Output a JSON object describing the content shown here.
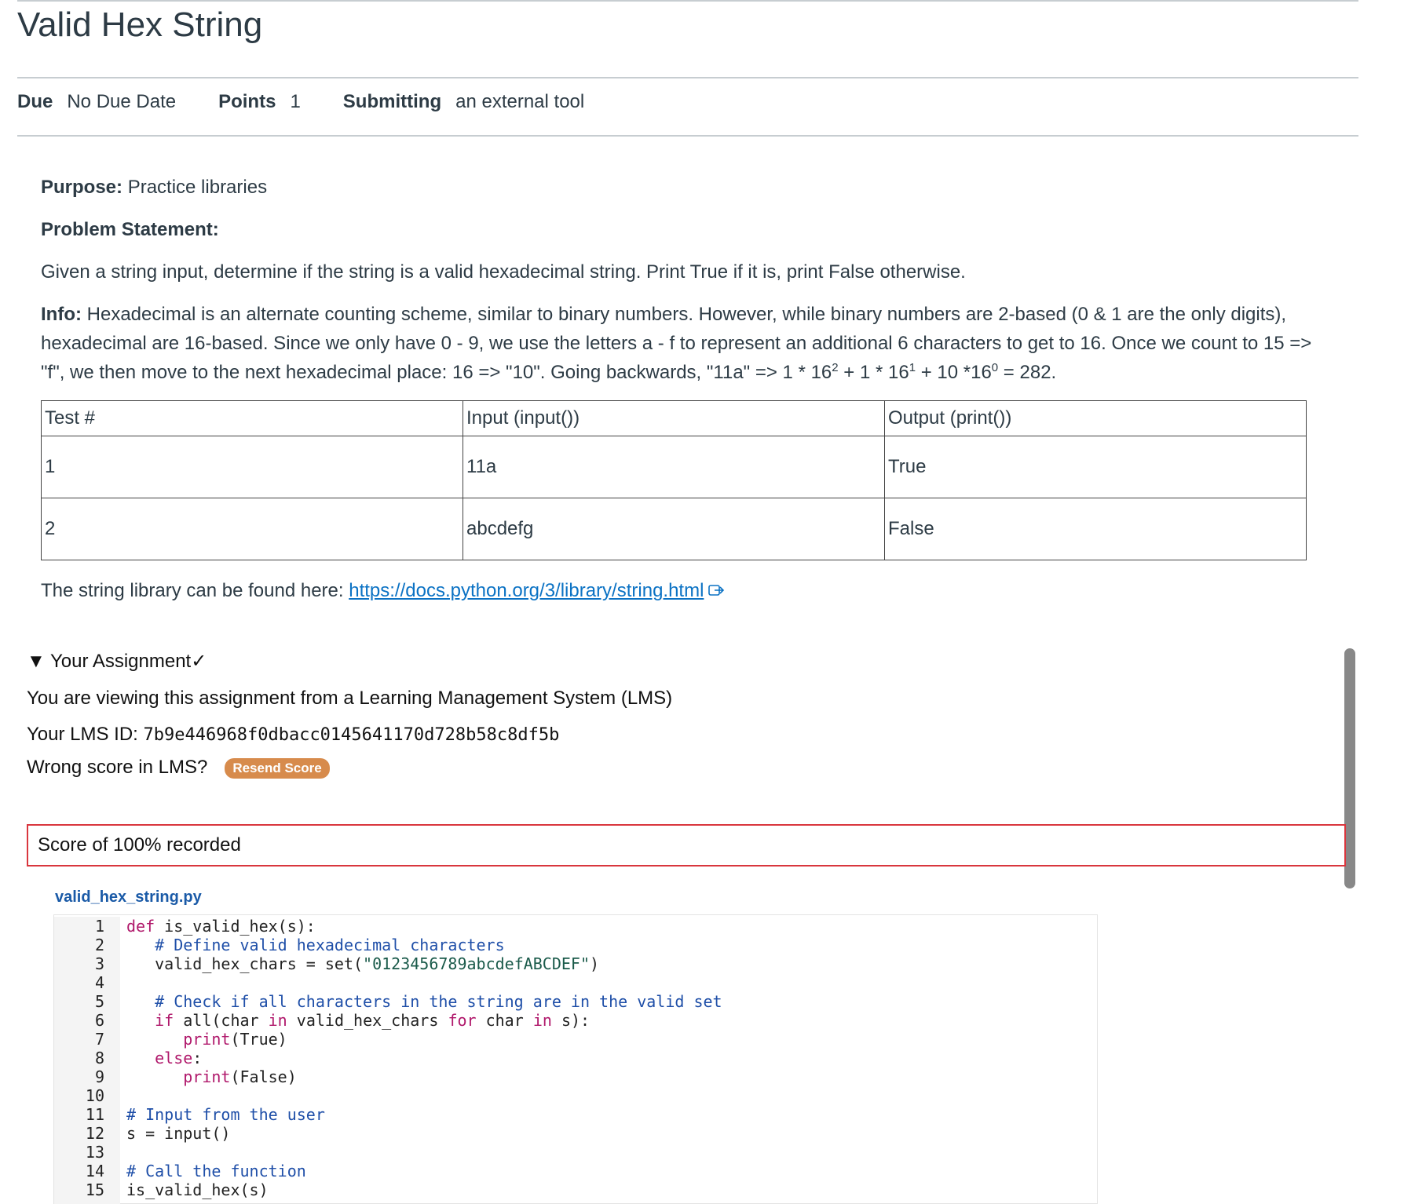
{
  "page": {
    "title": "Valid Hex String"
  },
  "meta": {
    "due_label": "Due",
    "due_value": "No Due Date",
    "points_label": "Points",
    "points_value": "1",
    "submitting_label": "Submitting",
    "submitting_value": "an external tool"
  },
  "description": {
    "purpose_label": "Purpose:",
    "purpose_text": "Practice libraries",
    "problem_label": "Problem Statement:",
    "problem_text": "Given a string input, determine if the string is a valid hexadecimal string. Print True if it is, print False otherwise.",
    "info_label": "Info:",
    "info_text_1": "Hexadecimal is an alternate counting scheme, similar to binary numbers. However, while binary numbers are 2-based (0 & 1 are the only digits), hexadecimal are 16-based. Since we only have 0 - 9, we use the letters a - f to represent an additional 6 characters to get to 16. Once we count to 15 => \"f\", we then move to the next hexadecimal place: 16 => \"10\". Going backwards, \"11a\" => 1 * 16",
    "sup_1": "2",
    "info_text_2": " + 1 * 16",
    "sup_2": "1",
    "info_text_3": " + 10 *16",
    "sup_3": "0",
    "info_text_4": " = 282."
  },
  "tests_table": {
    "headers": [
      "Test #",
      "Input (input())",
      "Output (print())"
    ],
    "rows": [
      [
        "1",
        "11a",
        "True"
      ],
      [
        "2",
        "abcdefg",
        "False"
      ]
    ]
  },
  "library": {
    "text": "The string library can be found here: ",
    "link": "https://docs.python.org/3/library/string.html"
  },
  "assignment": {
    "header": "▼ Your Assignment✓",
    "viewing": "You are viewing this assignment from a Learning Management System (LMS)",
    "lms_id_label": "Your LMS ID: ",
    "lms_id_value": "7b9e446968f0dbacc0145641170d728b58c8df5b",
    "wrong_score": "Wrong score in LMS?",
    "resend_label": "Resend Score",
    "score_text": "Score of 100% recorded",
    "filename": "valid_hex_string.py"
  },
  "code": {
    "line_numbers": [
      "1",
      "2",
      "3",
      "4",
      "5",
      "6",
      "7",
      "8",
      "9",
      "10",
      "11",
      "12",
      "13",
      "14",
      "15"
    ]
  },
  "colors": {
    "link": "#0b72c4",
    "resend_bg": "#d78b4c",
    "score_border": "#d9363e",
    "filename": "#1a5aa7"
  }
}
